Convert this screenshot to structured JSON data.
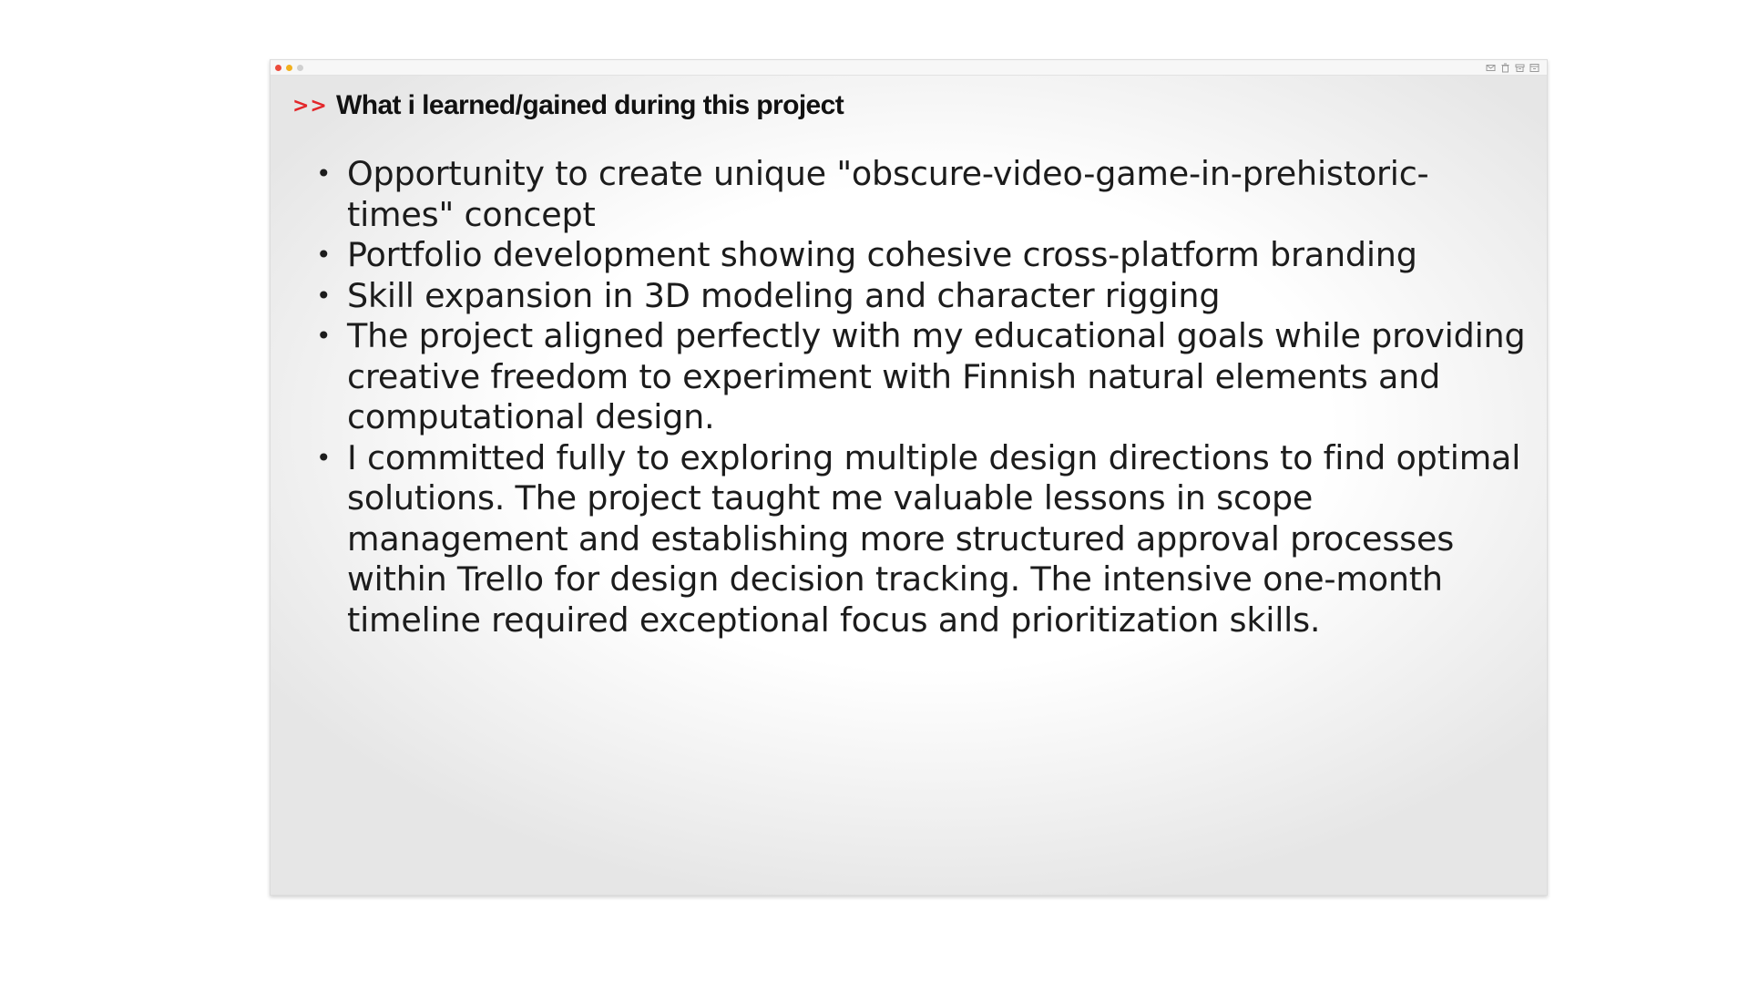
{
  "window": {
    "controls": [
      "close",
      "minimize",
      "zoom"
    ],
    "toolbar_icons": [
      "mail-icon",
      "trash-icon",
      "archive-icon",
      "inbox-icon"
    ]
  },
  "slide": {
    "chevrons": ">>",
    "heading": "What i learned/gained during this project",
    "bullets": [
      "Opportunity to create unique \"obscure-video-game-in-prehistoric-times\" concept",
      "Portfolio development showing cohesive cross-platform branding",
      "Skill expansion in 3D modeling and character rigging",
      "The project aligned perfectly with my educational goals while providing creative freedom to experiment with Finnish natural elements and computational design.",
      "I committed fully to exploring multiple design directions to find optimal solutions. The project taught me valuable lessons in scope management and establishing more structured approval processes within Trello for design decision tracking. The intensive one-month timeline required exceptional focus and prioritization skills."
    ]
  },
  "colors": {
    "accent": "#e3262a",
    "text": "#1c1c1c",
    "close": "#ec4b3c",
    "minimize": "#f2b01e",
    "inactive": "#d0d0d0"
  }
}
